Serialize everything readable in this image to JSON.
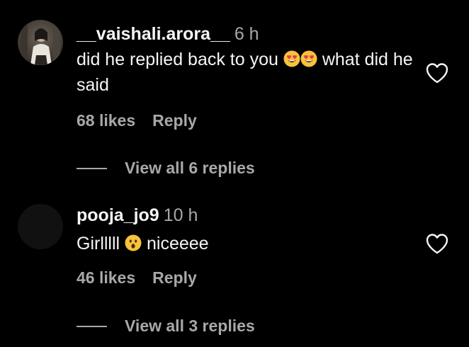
{
  "colors": {
    "background": "#000000",
    "text_primary": "#f5f5f5",
    "text_secondary": "#a8a8a8"
  },
  "comments": [
    {
      "username": "__vaishali.arora__",
      "time": "6 h",
      "text_before_emoji": "did he replied back to you",
      "emojis": [
        "heart-eyes-emoji",
        "heart-eyes-emoji"
      ],
      "text_after_emoji": "what did he said",
      "likes": "68 likes",
      "reply_label": "Reply",
      "view_replies": "View all 6 replies",
      "like_icon": "heart-outline-icon"
    },
    {
      "username": "pooja_jo9",
      "time": "10 h",
      "text_before_emoji": "Girlllll",
      "emojis": [
        "surprised-face-emoji"
      ],
      "text_after_emoji": "niceeee",
      "likes": "46 likes",
      "reply_label": "Reply",
      "view_replies": "View all 3 replies",
      "like_icon": "heart-outline-icon"
    }
  ]
}
